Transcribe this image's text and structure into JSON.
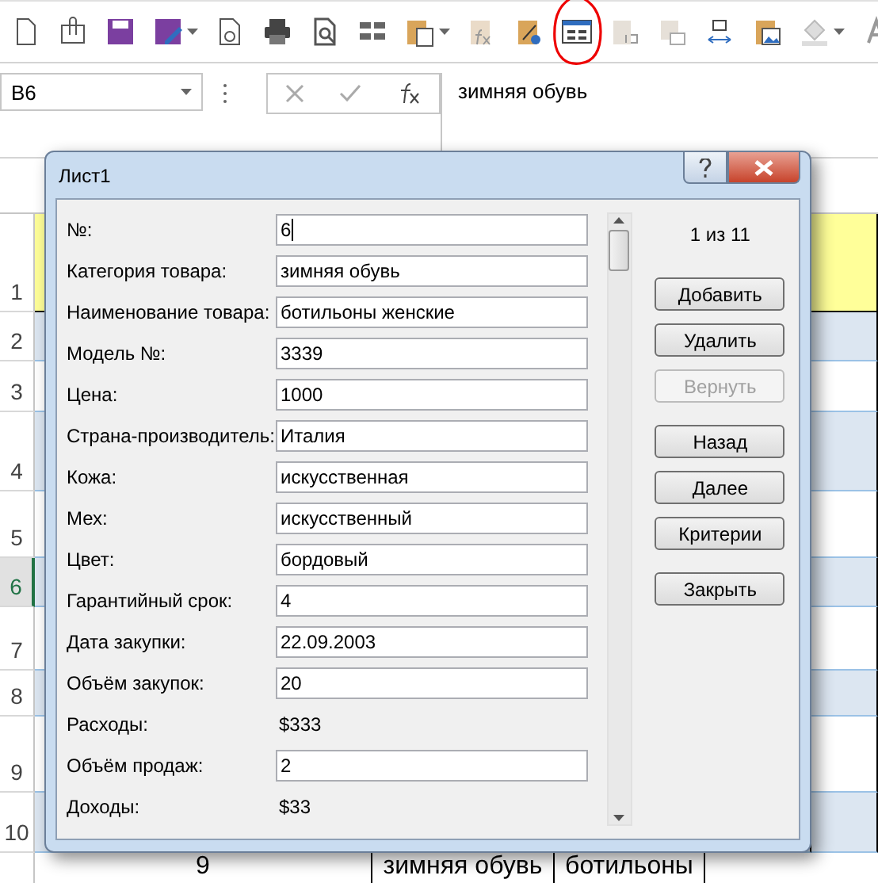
{
  "toolbar": [
    {
      "kind": "new-document",
      "dropdown": false,
      "circled": false
    },
    {
      "kind": "attachment",
      "dropdown": false,
      "circled": false
    },
    {
      "kind": "save",
      "dropdown": false,
      "circled": false
    },
    {
      "kind": "save-edit",
      "dropdown": true,
      "circled": false
    },
    {
      "kind": "document-settings",
      "dropdown": false,
      "circled": false
    },
    {
      "kind": "print",
      "dropdown": false,
      "circled": false
    },
    {
      "kind": "preview",
      "dropdown": false,
      "circled": false
    },
    {
      "kind": "grid",
      "dropdown": false,
      "circled": false
    },
    {
      "kind": "paste",
      "dropdown": true,
      "circled": false
    },
    {
      "kind": "paste-formula",
      "dropdown": false,
      "circled": false
    },
    {
      "kind": "paste-percent",
      "dropdown": false,
      "circled": false
    },
    {
      "kind": "form",
      "dropdown": false,
      "circled": true
    },
    {
      "kind": "paste-values",
      "dropdown": false,
      "circled": false
    },
    {
      "kind": "paste-link",
      "dropdown": false,
      "circled": false
    },
    {
      "kind": "width",
      "dropdown": false,
      "circled": false
    },
    {
      "kind": "paste-picture",
      "dropdown": false,
      "circled": false
    },
    {
      "kind": "fill",
      "dropdown": true,
      "circled": false
    },
    {
      "kind": "font",
      "dropdown": false,
      "circled": false
    }
  ],
  "name_box": {
    "value": "B6"
  },
  "formula_bar": {
    "value": "зимняя обувь"
  },
  "sheet": {
    "rows": [
      {
        "number": "1",
        "selected": false
      },
      {
        "number": "2",
        "selected": false
      },
      {
        "number": "3",
        "selected": false
      },
      {
        "number": "4",
        "selected": false
      },
      {
        "number": "5",
        "selected": false
      },
      {
        "number": "6",
        "selected": true
      },
      {
        "number": "7",
        "selected": false
      },
      {
        "number": "8",
        "selected": false
      },
      {
        "number": "9",
        "selected": false
      },
      {
        "number": "10",
        "selected": false
      }
    ],
    "last_row_cells": [
      "9",
      "зимняя обувь",
      "ботильоны"
    ]
  },
  "dialog": {
    "title": "Лист1",
    "record_counter": "1 из 11",
    "fields": [
      {
        "label": "№:",
        "value": "6",
        "kind": "input"
      },
      {
        "label": "Категория товара:",
        "value": "зимняя обувь",
        "kind": "input"
      },
      {
        "label": "Наименование товара:",
        "value": "ботильоны женские",
        "kind": "input"
      },
      {
        "label": "Модель №:",
        "value": "3339",
        "kind": "input"
      },
      {
        "label": "Цена:",
        "value": "1000",
        "kind": "input"
      },
      {
        "label": "Страна-производитель:",
        "value": "Италия",
        "kind": "input"
      },
      {
        "label": "Кожа:",
        "value": "искусственная",
        "kind": "input"
      },
      {
        "label": "Мех:",
        "value": "искусственный",
        "kind": "input"
      },
      {
        "label": "Цвет:",
        "value": "бордовый",
        "kind": "input"
      },
      {
        "label": "Гарантийный срок:",
        "value": "4",
        "kind": "input"
      },
      {
        "label": "Дата закупки:",
        "value": "22.09.2003",
        "kind": "input"
      },
      {
        "label": "Объём закупок:",
        "value": "20",
        "kind": "input"
      },
      {
        "label": "Расходы:",
        "value": "$333",
        "kind": "computed"
      },
      {
        "label": "Объём продаж:",
        "value": "2",
        "kind": "input"
      },
      {
        "label": "Доходы:",
        "value": "$33",
        "kind": "computed"
      }
    ],
    "button_groups": [
      [
        {
          "label": "Добавить",
          "disabled": false
        },
        {
          "label": "Удалить",
          "disabled": false
        },
        {
          "label": "Вернуть",
          "disabled": true
        }
      ],
      [
        {
          "label": "Назад",
          "disabled": false
        },
        {
          "label": "Далее",
          "disabled": false
        },
        {
          "label": "Критерии",
          "disabled": false
        }
      ],
      [
        {
          "label": "Закрыть",
          "disabled": false
        }
      ]
    ]
  }
}
